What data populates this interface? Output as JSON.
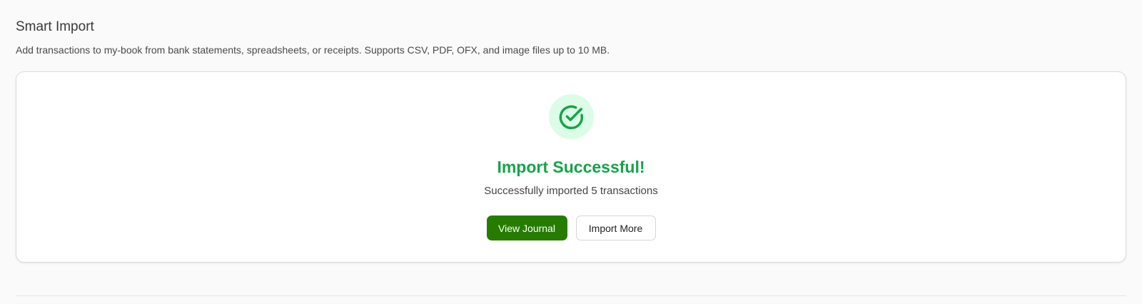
{
  "header": {
    "title": "Smart Import",
    "subtitle": "Add transactions to my-book from bank statements, spreadsheets, or receipts. Supports CSV, PDF, OFX, and image files up to 10 MB."
  },
  "result": {
    "icon": "check-circle-icon",
    "title": "Import Successful!",
    "message": "Successfully imported 5 transactions"
  },
  "actions": {
    "view_journal_label": "View Journal",
    "import_more_label": "Import More"
  },
  "colors": {
    "success_green": "#16a34a",
    "success_bg": "#dcfce7",
    "primary_button": "#267c00"
  }
}
